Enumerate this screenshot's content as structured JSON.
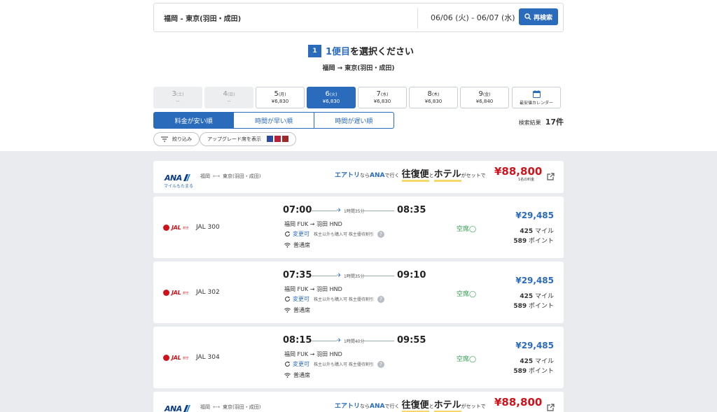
{
  "search": {
    "route": "福岡 - 東京(羽田・成田)",
    "dates": "06/06 (火) - 06/07 (水)",
    "button_label": "再検索"
  },
  "step": {
    "badge": "1",
    "title_num": "1便目",
    "title_rest": "を選択ください",
    "route": "福岡 → 東京(羽田・成田)"
  },
  "date_tabs": [
    {
      "day": "3",
      "dow": "(土)",
      "price": "--",
      "state": "disabled"
    },
    {
      "day": "4",
      "dow": "(日)",
      "price": "--",
      "state": "disabled"
    },
    {
      "day": "5",
      "dow": "(月)",
      "price": "¥6,830",
      "state": "normal"
    },
    {
      "day": "6",
      "dow": "(火)",
      "price": "¥6,830",
      "state": "active"
    },
    {
      "day": "7",
      "dow": "(水)",
      "price": "¥6,830",
      "state": "normal"
    },
    {
      "day": "8",
      "dow": "(木)",
      "price": "¥6,830",
      "state": "normal"
    },
    {
      "day": "9",
      "dow": "(金)",
      "price": "¥6,840",
      "state": "normal"
    }
  ],
  "calendar_label": "最安値カレンダー",
  "sort": {
    "cheapest": "料金が安い順",
    "earliest": "時間が早い順",
    "latest": "時間が遅い順"
  },
  "results": {
    "label": "検索結果",
    "count": "17件"
  },
  "filters": {
    "narrow": "絞り込み",
    "upgrade": "アップグレード席を表示"
  },
  "promo": {
    "logo_text": "ANA",
    "miles_link": "マイルもたまる",
    "from": "福岡",
    "arrow": "⟷",
    "to": "東京(羽田・成田)",
    "copy_a": "エアトリ",
    "copy_b": "なら",
    "copy_c": "ANA",
    "copy_d": "で行く",
    "copy_e": "往復便",
    "copy_f": "と",
    "copy_g": "ホテル",
    "copy_h": "がセットで",
    "price": "¥88,800",
    "note": "1名の料金"
  },
  "flights": [
    {
      "airline_text": "JAL",
      "airline_sub": "航空",
      "flight_no": "JAL 300",
      "dep": "07:00",
      "arr": "08:35",
      "duration": "1時間35分",
      "airports": "福岡 FUK → 羽田 HND",
      "change": "変更可",
      "change_note": "株主以外も購入可 株主優待割引",
      "seat_class": "普通席",
      "availability": "空席◯",
      "price": "¥29,485",
      "miles": "425",
      "miles_label": "マイル",
      "points": "589",
      "points_label": "ポイント"
    },
    {
      "airline_text": "JAL",
      "airline_sub": "航空",
      "flight_no": "JAL 302",
      "dep": "07:35",
      "arr": "09:10",
      "duration": "1時間35分",
      "airports": "福岡 FUK → 羽田 HND",
      "change": "変更可",
      "change_note": "株主以外も購入可 株主優待割引",
      "seat_class": "普通席",
      "availability": "空席◯",
      "price": "¥29,485",
      "miles": "425",
      "miles_label": "マイル",
      "points": "589",
      "points_label": "ポイント"
    },
    {
      "airline_text": "JAL",
      "airline_sub": "航空",
      "flight_no": "JAL 304",
      "dep": "08:15",
      "arr": "09:55",
      "duration": "1時間40分",
      "airports": "福岡 FUK → 羽田 HND",
      "change": "変更可",
      "change_note": "株主以外も購入可 株主優待割引",
      "seat_class": "普通席",
      "availability": "空席◯",
      "price": "¥29,485",
      "miles": "425",
      "miles_label": "マイル",
      "points": "589",
      "points_label": "ポイント"
    }
  ],
  "colors": {
    "accent": "#2a6bbb",
    "price_red": "#d0121b",
    "available_green": "#2a9a4a"
  }
}
